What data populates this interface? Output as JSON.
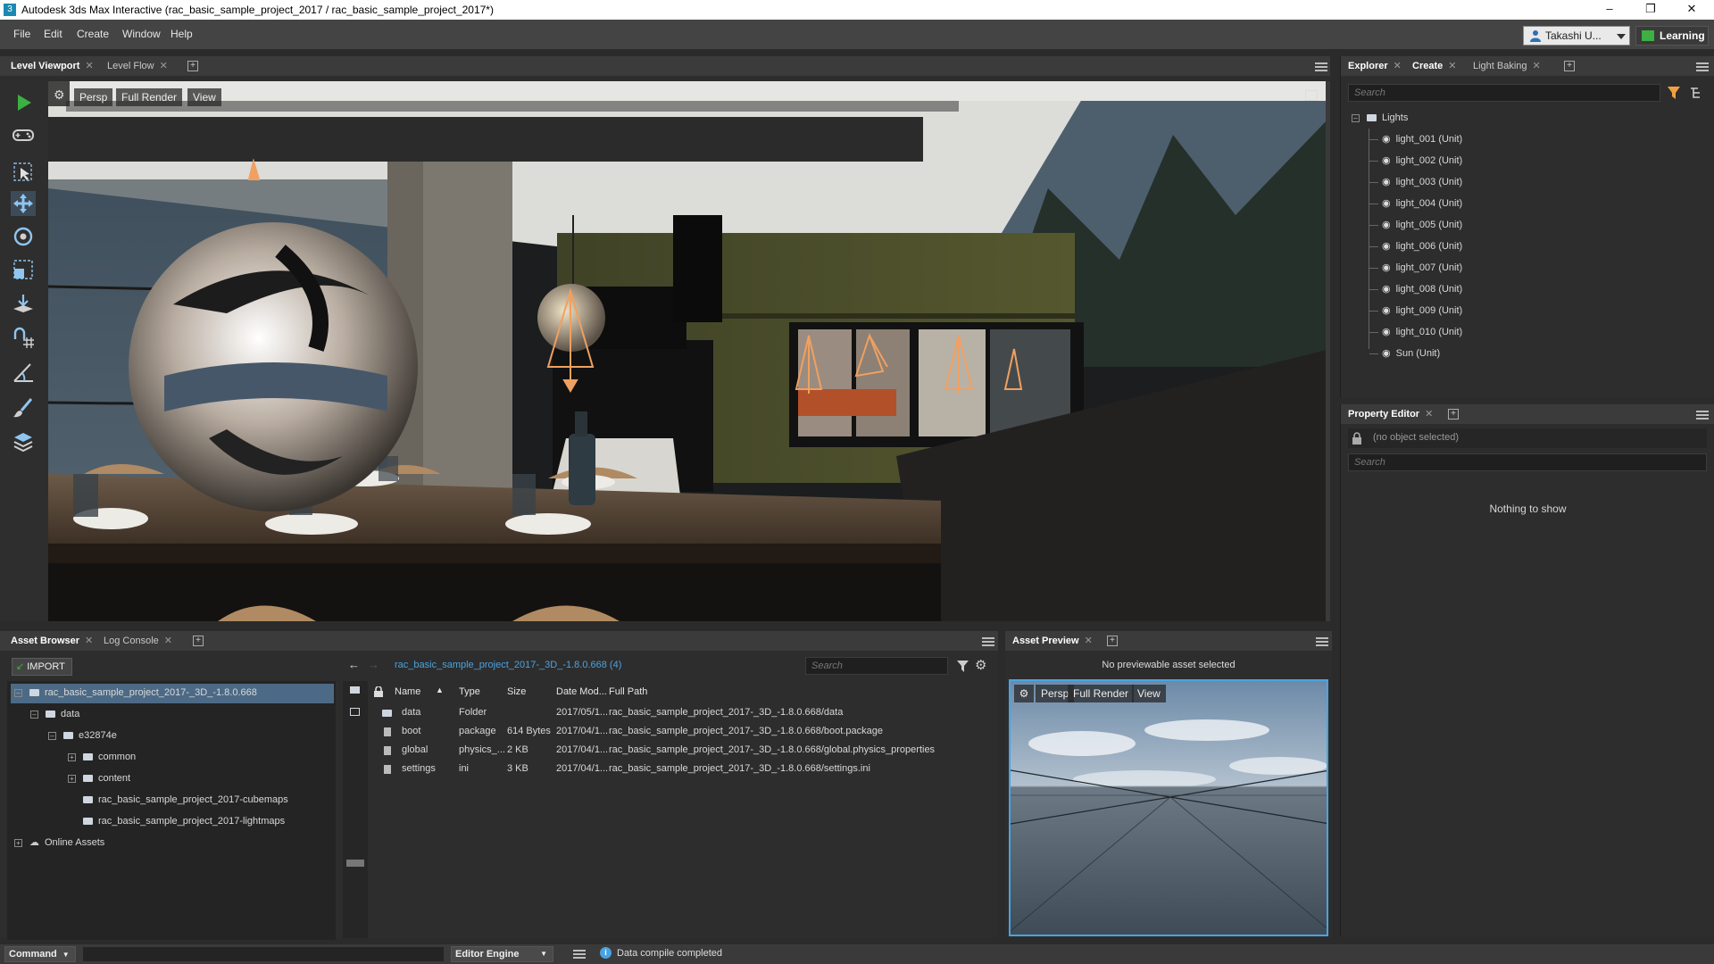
{
  "window": {
    "title": "Autodesk 3ds Max Interactive (rac_basic_sample_project_2017 / rac_basic_sample_project_2017*)",
    "app_icon": "3",
    "minimize": "–",
    "restore": "❐",
    "close": "✕"
  },
  "menu": {
    "items": [
      "File",
      "Edit",
      "Create",
      "Window",
      "Help"
    ],
    "user_label": "Takashi U...",
    "learning_label": "Learning"
  },
  "viewport_panel": {
    "tabs": [
      {
        "label": "Level Viewport",
        "active": true
      },
      {
        "label": "Level Flow",
        "active": false
      }
    ],
    "camera_label": "Persp",
    "render_label": "Full Render",
    "view_label": "View"
  },
  "explorer_panel": {
    "tabs": [
      {
        "label": "Explorer",
        "active": true
      },
      {
        "label": "Create",
        "active": true
      },
      {
        "label": "Light Baking",
        "active": false
      }
    ],
    "search_placeholder": "Search",
    "root_label": "Lights",
    "items": [
      "light_001 (Unit)",
      "light_002 (Unit)",
      "light_003 (Unit)",
      "light_004 (Unit)",
      "light_005 (Unit)",
      "light_006 (Unit)",
      "light_007 (Unit)",
      "light_008 (Unit)",
      "light_009 (Unit)",
      "light_010 (Unit)",
      "Sun (Unit)"
    ]
  },
  "property_editor": {
    "tab_label": "Property Editor",
    "selection_text": "(no object selected)",
    "search_placeholder": "Search",
    "empty_text": "Nothing to show"
  },
  "asset_browser": {
    "tabs": [
      {
        "label": "Asset Browser",
        "active": true
      },
      {
        "label": "Log Console",
        "active": false
      }
    ],
    "import_label": "IMPORT",
    "tree": [
      {
        "label": "rac_basic_sample_project_2017-_3D_-1.8.0.668",
        "depth": 0,
        "expander": "–",
        "selected": true
      },
      {
        "label": "data",
        "depth": 1,
        "expander": "–"
      },
      {
        "label": "e32874e",
        "depth": 2,
        "expander": "–"
      },
      {
        "label": "common",
        "depth": 3,
        "expander": "+"
      },
      {
        "label": "content",
        "depth": 3,
        "expander": "+"
      },
      {
        "label": "rac_basic_sample_project_2017-cubemaps",
        "depth": 3,
        "expander": ""
      },
      {
        "label": "rac_basic_sample_project_2017-lightmaps",
        "depth": 3,
        "expander": ""
      },
      {
        "label": "Online Assets",
        "depth": 0,
        "expander": "+"
      }
    ],
    "breadcrumb": "rac_basic_sample_project_2017-_3D_-1.8.0.668 (4)",
    "search_placeholder": "Search",
    "columns": [
      "Name",
      "Type",
      "Size",
      "Date Mod...",
      "Full Path"
    ],
    "rows": [
      {
        "name": "data",
        "type": "Folder",
        "size": "",
        "date": "2017/05/1...",
        "path": "rac_basic_sample_project_2017-_3D_-1.8.0.668/data",
        "kind": "folder"
      },
      {
        "name": "boot",
        "type": "package",
        "size": "614 Bytes",
        "date": "2017/04/1...",
        "path": "rac_basic_sample_project_2017-_3D_-1.8.0.668/boot.package",
        "kind": "file"
      },
      {
        "name": "global",
        "type": "physics_...",
        "size": "2 KB",
        "date": "2017/04/1...",
        "path": "rac_basic_sample_project_2017-_3D_-1.8.0.668/global.physics_properties",
        "kind": "file"
      },
      {
        "name": "settings",
        "type": "ini",
        "size": "3 KB",
        "date": "2017/04/1...",
        "path": "rac_basic_sample_project_2017-_3D_-1.8.0.668/settings.ini",
        "kind": "file"
      }
    ]
  },
  "asset_preview": {
    "tab_label": "Asset Preview",
    "message": "No previewable asset selected",
    "camera_label": "Persp",
    "render_label": "Full Render",
    "view_label": "View"
  },
  "statusbar": {
    "command_label": "Command",
    "engine_label": "Editor Engine",
    "message": "Data compile completed"
  },
  "colors": {
    "accent": "#4aa3df",
    "selection": "#4c6a86",
    "play_green": "#3cb043",
    "light_gizmo": "#f0a060"
  }
}
